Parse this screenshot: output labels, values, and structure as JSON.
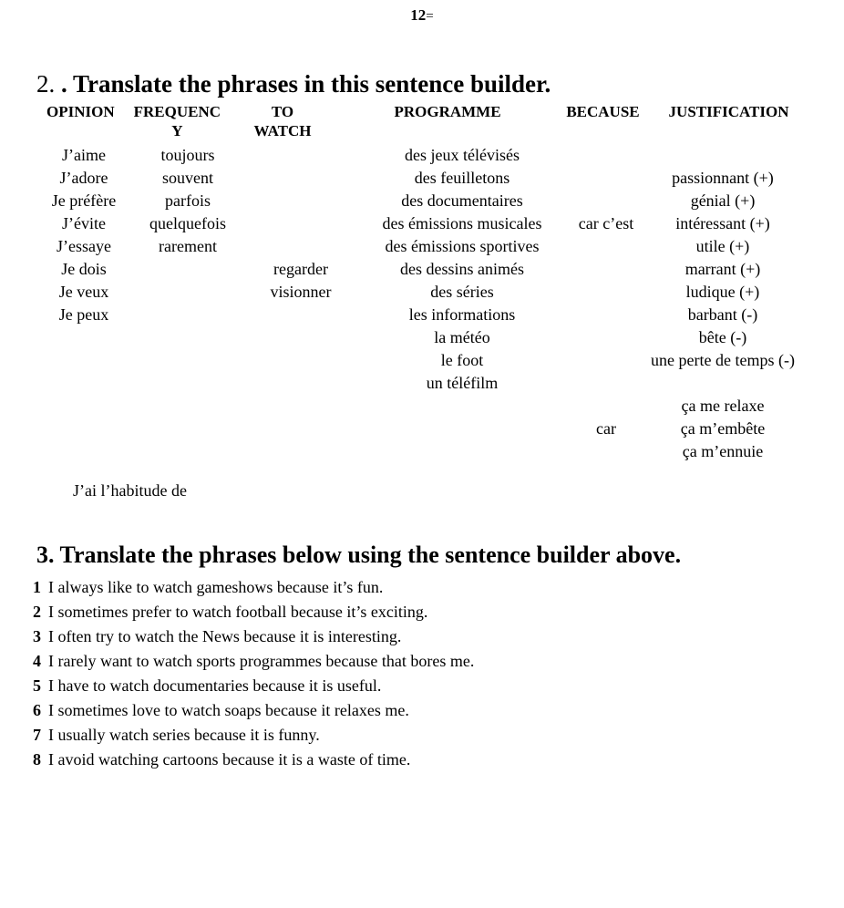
{
  "page": {
    "number": "12",
    "equals_mark": "="
  },
  "section2": {
    "number": "2. ",
    "title": ". Translate the phrases in this sentence builder.",
    "columns": {
      "opinion": "OPINION",
      "frequency": "FREQUENC\nY",
      "to_watch": "TO\nWATCH",
      "programme": "PROGRAMME",
      "because": "BECAUSE",
      "justification": "JUSTIFICATION"
    },
    "opinion": [
      "J’aime",
      "J’adore",
      "Je préfère",
      "J’évite",
      "J’essaye",
      "Je dois",
      "Je veux",
      "Je peux"
    ],
    "frequency": [
      "toujours",
      "souvent",
      "parfois",
      "quelquefois",
      "rarement"
    ],
    "to_watch": [
      "regarder",
      "visionner"
    ],
    "programme": [
      "des jeux télévisés",
      "des feuilletons",
      "des documentaires",
      "des émissions musicales",
      "des émissions sportives",
      "des dessins animés",
      "des séries",
      "les informations",
      "la météo",
      "le foot",
      "un téléfilm"
    ],
    "because": [
      "car c’est"
    ],
    "because_lower": [
      "car"
    ],
    "justification": [
      "passionnant (+)",
      "génial (+)",
      "intéressant (+)",
      "utile (+)",
      "marrant (+)",
      "ludique (+)",
      "barbant (-)",
      "bête (-)",
      "une perte de temps (-)"
    ],
    "justification_lower": [
      "ça me relaxe",
      "ça m’embête",
      "ça m’ennuie"
    ],
    "habit_phrase": "J’ai l’habitude de"
  },
  "section3": {
    "number": "3. ",
    "title": "Translate the phrases below using the sentence builder above.",
    "items": [
      {
        "num": "1",
        "text": "I always like to watch gameshows because it’s fun."
      },
      {
        "num": "2",
        "text": "I sometimes prefer to watch football because it’s exciting."
      },
      {
        "num": "3",
        "text": "I often try to watch the News because it is interesting."
      },
      {
        "num": "4",
        "text": "I rarely want to watch sports programmes because that bores me."
      },
      {
        "num": "5",
        "text": "I have to watch documentaries because it is useful."
      },
      {
        "num": "6",
        "text": "I sometimes love to watch soaps because it relaxes me."
      },
      {
        "num": "7",
        "text": "I usually watch series because it is funny."
      },
      {
        "num": "8",
        "text": "I avoid watching cartoons because it is a waste of time."
      }
    ]
  }
}
